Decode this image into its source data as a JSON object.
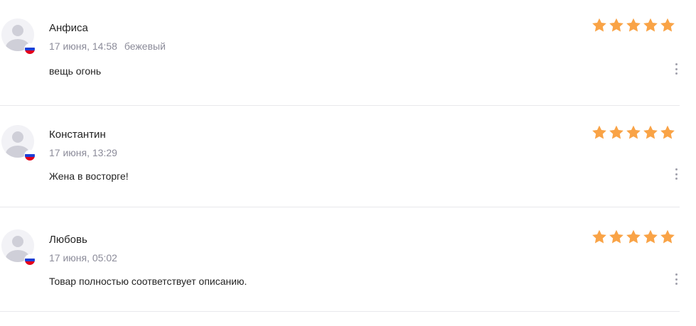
{
  "colors": {
    "star": "#f9a346",
    "divider": "#e8e8ec",
    "meta_text": "#8b8b99",
    "flag_white": "#ffffff",
    "flag_blue": "#1c3fd6",
    "flag_red": "#e3001b"
  },
  "reviews": [
    {
      "author": "Анфиса",
      "date": "17 июня, 14:58",
      "variant": "бежевый",
      "text": "вещь огонь",
      "rating": 5
    },
    {
      "author": "Константин",
      "date": "17 июня, 13:29",
      "variant": "",
      "text": "Жена в восторге!",
      "rating": 5
    },
    {
      "author": "Любовь",
      "date": "17 июня, 05:02",
      "variant": "",
      "text": "Товар полностью соответствует описанию.",
      "rating": 5
    }
  ],
  "icons": {
    "avatar": "user-avatar-icon",
    "flag": "russia-flag-icon",
    "star": "star-icon",
    "more": "more-vertical-icon"
  }
}
